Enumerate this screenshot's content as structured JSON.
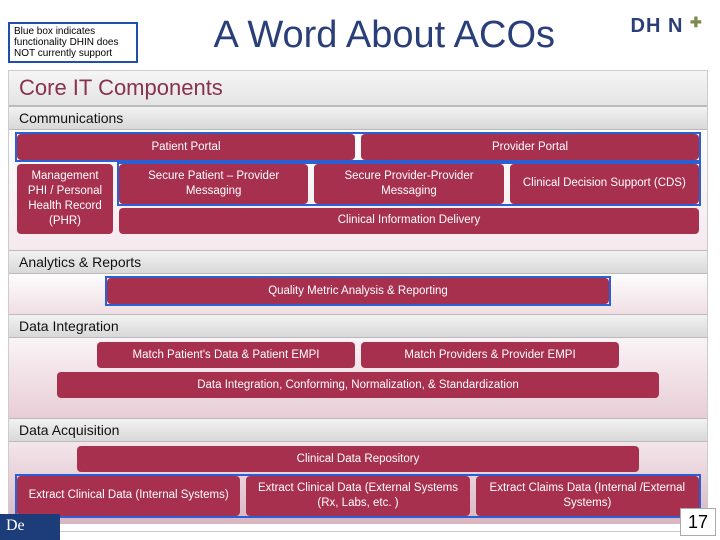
{
  "header": {
    "note": "Blue box indicates functionality DHIN does NOT currently support",
    "title": "A Word About ACOs",
    "logo_text": "DH  N"
  },
  "diagram": {
    "core_header": "Core IT Components",
    "sections": {
      "communications": {
        "label": "Communications",
        "row1": [
          "Patient Portal",
          "Provider Portal"
        ],
        "row2_side": "Management PHI / Personal Health Record (PHR)",
        "row2": [
          "Secure Patient – Provider Messaging",
          "Secure Provider-Provider Messaging",
          "Clinical Decision Support (CDS)"
        ],
        "row3": "Clinical Information Delivery"
      },
      "analytics": {
        "label": "Analytics & Reports",
        "row1": "Quality Metric Analysis & Reporting"
      },
      "data_integration": {
        "label": "Data Integration",
        "row1": [
          "Match Patient's Data & Patient EMPI",
          "Match Providers & Provider EMPI"
        ],
        "row2": "Data Integration, Conforming, Normalization, & Standardization"
      },
      "data_acquisition": {
        "label": "Data Acquisition",
        "row1": "Clinical Data Repository",
        "row2": [
          "Extract Clinical Data (Internal Systems)",
          "Extract Clinical Data (External Systems (Rx, Labs, etc. )",
          "Extract Claims Data (Internal /External Systems)"
        ]
      }
    }
  },
  "footer": {
    "left": "De",
    "page": "17"
  }
}
